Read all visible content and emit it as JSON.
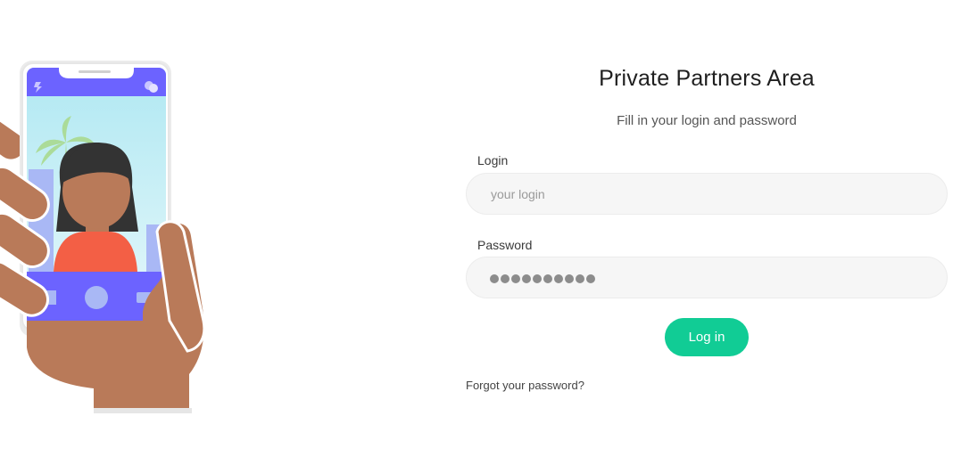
{
  "header": {
    "title": "Private Partners Area",
    "subtitle": "Fill in your login and password"
  },
  "form": {
    "login_label": "Login",
    "login_placeholder": "your login",
    "login_value": "",
    "password_label": "Password",
    "password_masked_length": 10,
    "submit_label": "Log in",
    "forgot_link": "Forgot your password?"
  },
  "colors": {
    "accent": "#11cc95",
    "phone_accent": "#6c63ff",
    "skin": "#b97a59",
    "shirt": "#f35f45",
    "hair": "#333333",
    "sky": "#c4eef5"
  },
  "icons": {
    "illustration": "hand-holding-phone-selfie-illustration"
  }
}
